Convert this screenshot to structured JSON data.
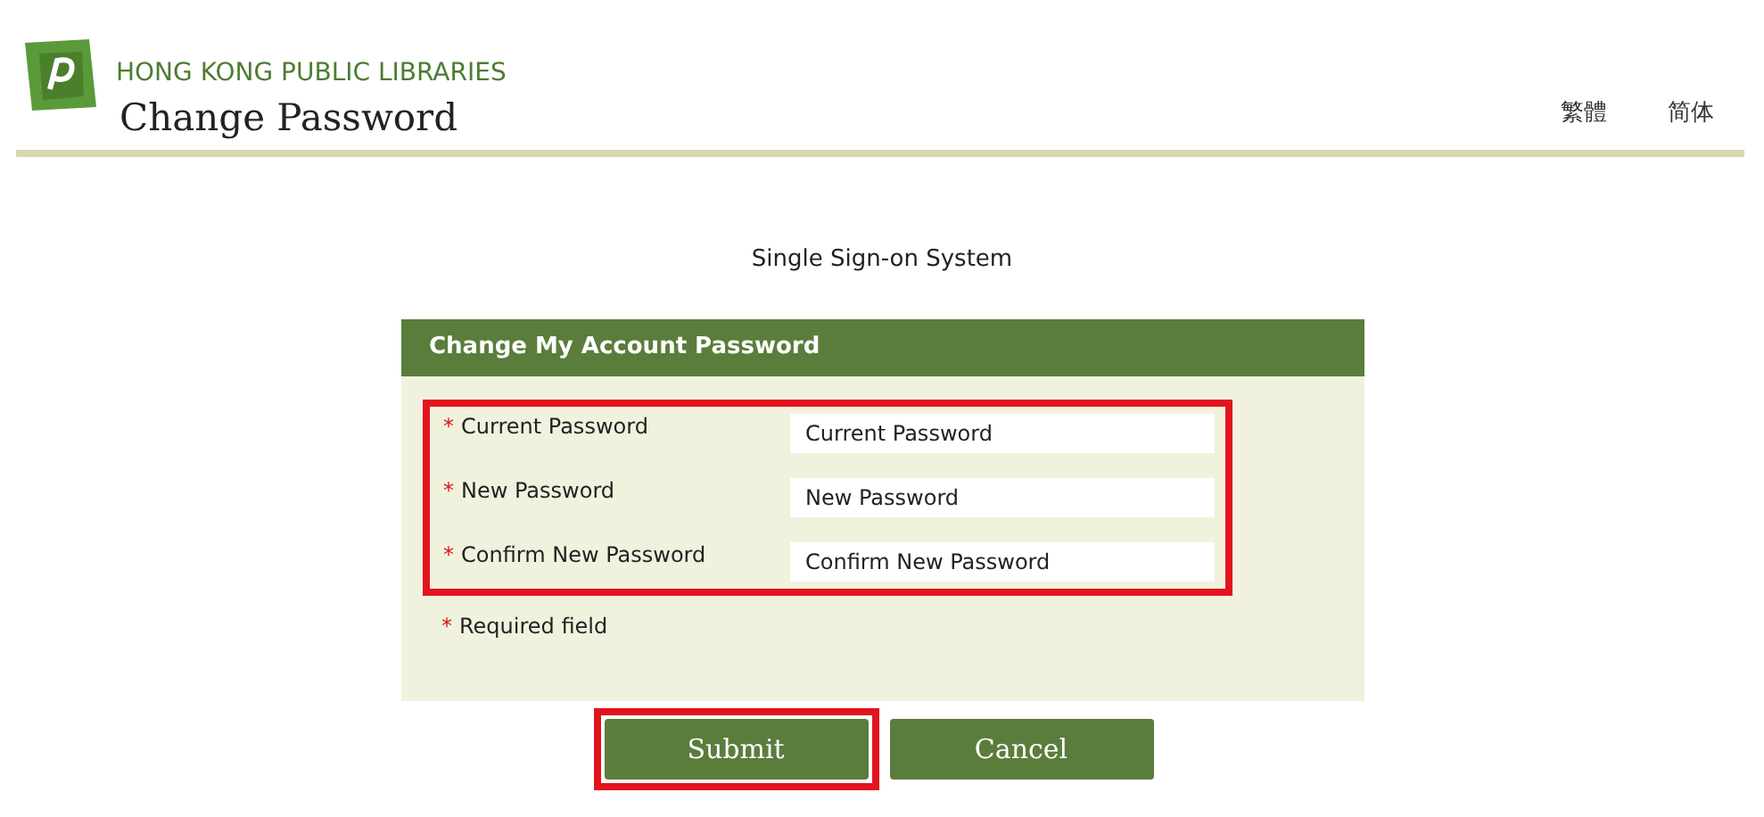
{
  "header": {
    "org_name": "HONG KONG PUBLIC LIBRARIES",
    "title": "Change Password",
    "languages": [
      {
        "label": "繁體"
      },
      {
        "label": "简体"
      }
    ]
  },
  "system_name": "Single Sign-on System",
  "panel": {
    "title": "Change My Account Password",
    "highlighted": true,
    "fields": [
      {
        "required_mark": "*",
        "label": "Current Password",
        "placeholder": "Current Password"
      },
      {
        "required_mark": "*",
        "label": "New Password",
        "placeholder": "New Password"
      },
      {
        "required_mark": "*",
        "label": "Confirm New Password",
        "placeholder": "Confirm New Password"
      }
    ],
    "note": {
      "required_mark": "*",
      "text": "Required field"
    }
  },
  "buttons": [
    {
      "label": "Submit",
      "highlighted": true
    },
    {
      "label": "Cancel",
      "highlighted": false
    }
  ]
}
